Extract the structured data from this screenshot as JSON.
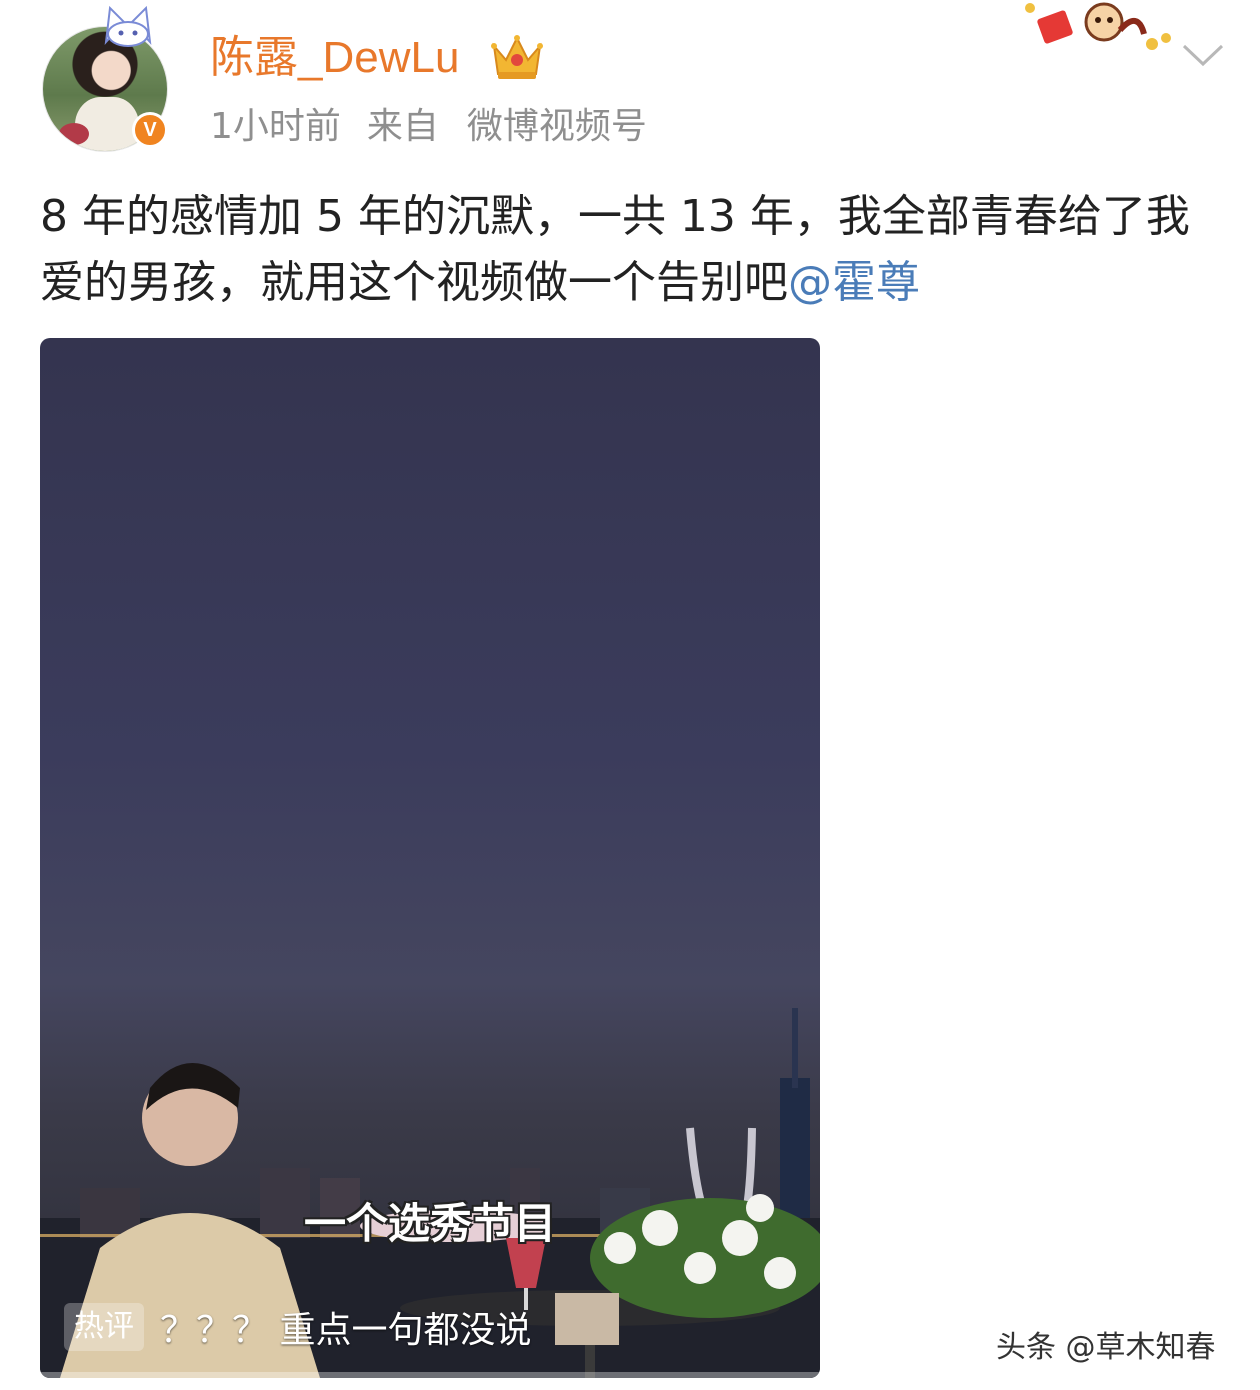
{
  "header": {
    "username": "陈露_DewLu",
    "verified_mark": "V",
    "time": "1小时前",
    "from_label": "来自",
    "source": "微博视频号"
  },
  "post": {
    "text": "8 年的感情加 5 年的沉默，一共 13 年，我全部青春给了我爱的男孩，就用这个视频做一个告别吧",
    "mention": "@霍尊"
  },
  "video": {
    "subtitle": "一个选秀节目",
    "hot_comment_tag": "热评",
    "hot_comment_text": "？？？ 重点一句都没说"
  },
  "watermark": "头条 @草木知春",
  "colors": {
    "username": "#e8782b",
    "mention": "#4a7cb8",
    "verified": "#f08420",
    "meta": "#8f8f8f"
  },
  "icons": [
    "crown-icon",
    "verified-icon",
    "chevron-down-icon",
    "cat-ears-icon"
  ]
}
